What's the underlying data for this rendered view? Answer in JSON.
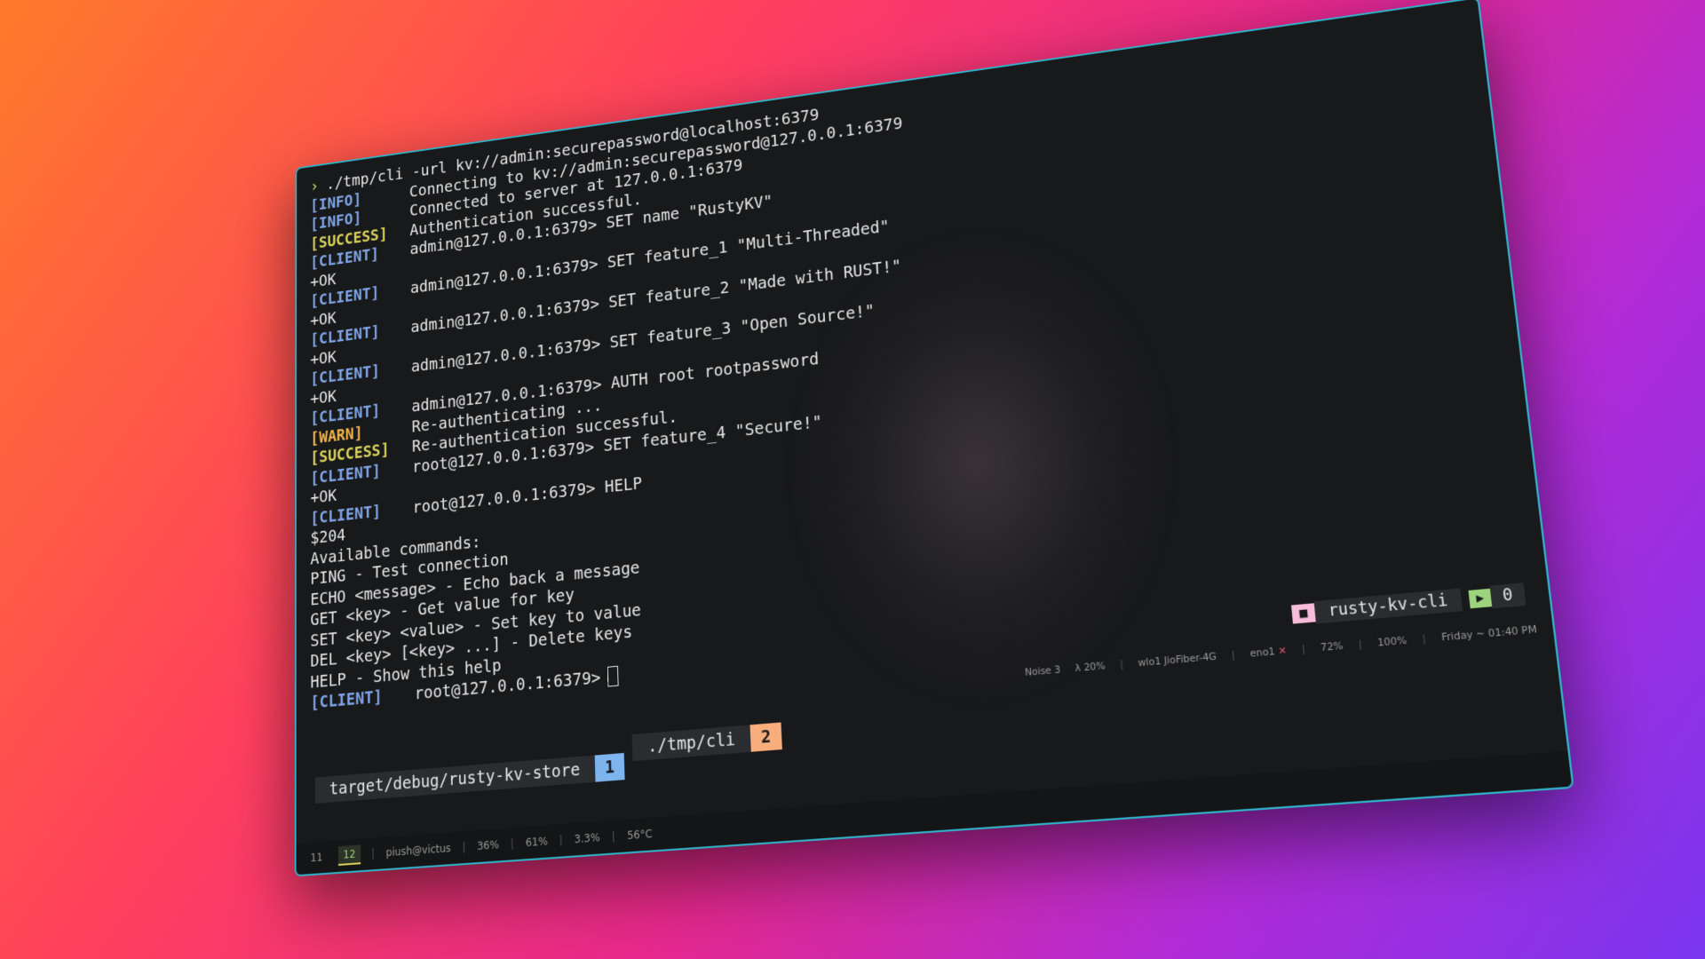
{
  "terminal": {
    "lines": [
      {
        "type": "prompt",
        "arrow": "›",
        "text": "./tmp/cli -url kv://admin:securepassword@localhost:6379"
      },
      {
        "type": "tag",
        "tag": "[INFO]",
        "kind": "info",
        "text": "Connecting to kv://admin:securepassword@127.0.0.1:6379"
      },
      {
        "type": "tag",
        "tag": "[INFO]",
        "kind": "info",
        "text": "Connected to server at 127.0.0.1:6379"
      },
      {
        "type": "tag",
        "tag": "[SUCCESS]",
        "kind": "success",
        "text": "Authentication successful."
      },
      {
        "type": "tag",
        "tag": "[CLIENT]",
        "kind": "client",
        "text": "admin@127.0.0.1:6379> SET name \"RustyKV\""
      },
      {
        "type": "plain",
        "text": "+OK"
      },
      {
        "type": "tag",
        "tag": "[CLIENT]",
        "kind": "client",
        "text": "admin@127.0.0.1:6379> SET feature_1 \"Multi-Threaded\""
      },
      {
        "type": "plain",
        "text": "+OK"
      },
      {
        "type": "tag",
        "tag": "[CLIENT]",
        "kind": "client",
        "text": "admin@127.0.0.1:6379> SET feature_2 \"Made with RUST!\""
      },
      {
        "type": "plain",
        "text": "+OK"
      },
      {
        "type": "tag",
        "tag": "[CLIENT]",
        "kind": "client",
        "text": "admin@127.0.0.1:6379> SET feature_3 \"Open Source!\""
      },
      {
        "type": "plain",
        "text": "+OK"
      },
      {
        "type": "tag",
        "tag": "[CLIENT]",
        "kind": "client",
        "text": "admin@127.0.0.1:6379> AUTH root rootpassword"
      },
      {
        "type": "tag",
        "tag": "[WARN]",
        "kind": "warn",
        "text": "Re-authenticating ..."
      },
      {
        "type": "tag",
        "tag": "[SUCCESS]",
        "kind": "success",
        "text": "Re-authentication successful."
      },
      {
        "type": "tag",
        "tag": "[CLIENT]",
        "kind": "client",
        "text": "root@127.0.0.1:6379> SET feature_4 \"Secure!\""
      },
      {
        "type": "plain",
        "text": "+OK"
      },
      {
        "type": "tag",
        "tag": "[CLIENT]",
        "kind": "client",
        "text": "root@127.0.0.1:6379> HELP"
      },
      {
        "type": "plain",
        "text": "$204"
      },
      {
        "type": "plain",
        "text": "Available commands:"
      },
      {
        "type": "plain",
        "text": "PING - Test connection"
      },
      {
        "type": "plain",
        "text": "ECHO <message> - Echo back a message"
      },
      {
        "type": "plain",
        "text": "GET <key> - Get value for key"
      },
      {
        "type": "plain",
        "text": "SET <key> <value> - Set key to value"
      },
      {
        "type": "plain",
        "text": "DEL <key> [<key> ...] - Delete keys"
      },
      {
        "type": "plain",
        "text": "HELP - Show this help"
      },
      {
        "type": "cursor",
        "tag": "[CLIENT]",
        "kind": "client",
        "text": "root@127.0.0.1:6379>"
      }
    ]
  },
  "pane": {
    "folder_icon": "folder-icon",
    "dir_name": "rusty-kv-cli",
    "terminal_icon": "terminal-icon",
    "count": "0"
  },
  "tabs": [
    {
      "name": "target/debug/rusty-kv-store",
      "num": "1"
    },
    {
      "name": "./tmp/cli",
      "num": "2"
    }
  ],
  "sysinfo": {
    "noise": "Noise 3",
    "lambda": "λ 20%",
    "wifi": "wlo1 JioFiber-4G",
    "eth": "eno1",
    "eth_status": "✕",
    "battery": "72%",
    "brightness": "100%",
    "datetime": "Friday ~ 01:40 PM"
  },
  "bottombar": {
    "workspaces": [
      "11",
      "12"
    ],
    "user": "piush@victus",
    "disk": "36%",
    "mem": "61%",
    "cpu": "3.3%",
    "temp": "56°C"
  }
}
